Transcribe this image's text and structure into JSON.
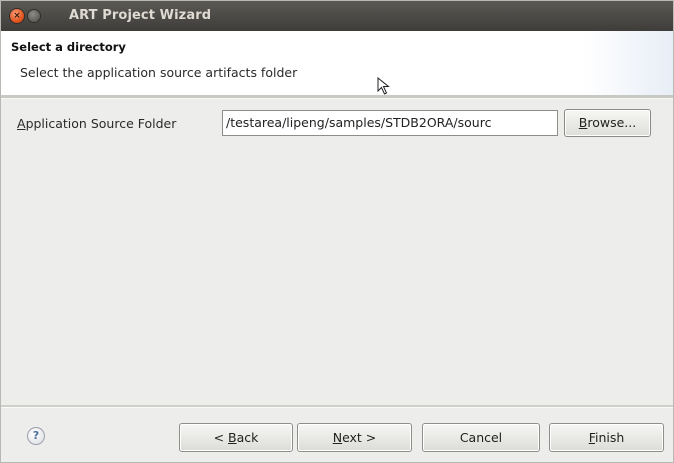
{
  "window": {
    "title": "ART Project Wizard",
    "close_glyph": "×"
  },
  "header": {
    "title": "Select a directory",
    "description": "Select the application source artifacts folder"
  },
  "form": {
    "source_folder_label_mnemonic": "A",
    "source_folder_label_rest": "pplication Source Folder",
    "source_folder_value": "/testarea/lipeng/samples/STDB2ORA/sourc",
    "browse_label_mnemonic": "B",
    "browse_label_rest": "rowse..."
  },
  "footer": {
    "help_glyph": "?",
    "back_prefix": "< ",
    "back_mnemonic": "B",
    "back_rest": "ack",
    "next_mnemonic": "N",
    "next_rest": "ext >",
    "cancel_label": "Cancel",
    "finish_mnemonic": "F",
    "finish_rest": "inish"
  },
  "icons": {
    "close": "close-icon",
    "minimize": "minimize-icon",
    "help": "help-icon",
    "cursor": "mouse-pointer-icon"
  },
  "colors": {
    "titlebar": "#3e3d3a",
    "close_button": "#e2541f",
    "dialog_background": "#ededeb",
    "banner_background": "#ffffff",
    "help_icon": "#4d6f9c"
  }
}
